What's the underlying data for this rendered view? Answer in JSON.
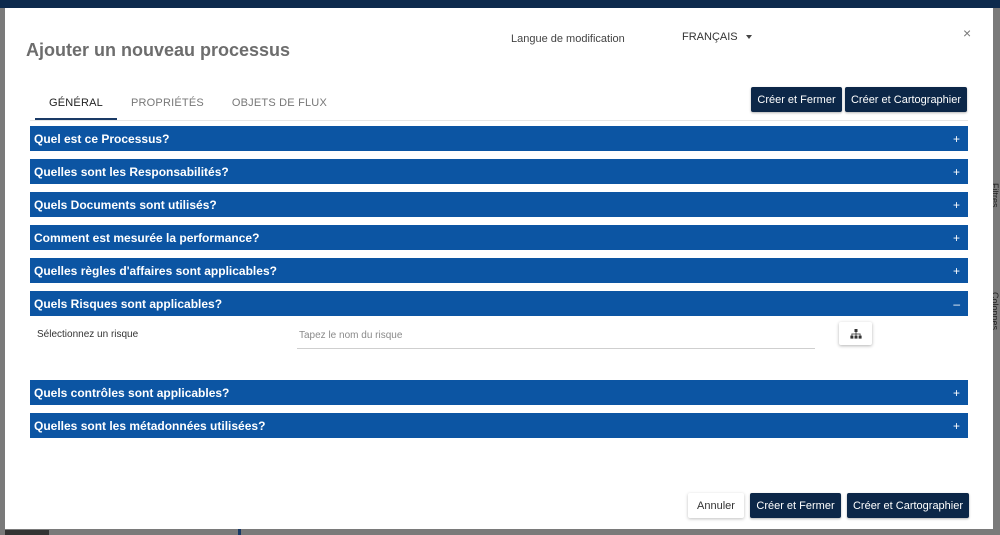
{
  "modal": {
    "title": "Ajouter un nouveau processus",
    "close_symbol": "×",
    "language_label": "Langue de modification",
    "language_value": "FRANÇAIS"
  },
  "tabs": [
    {
      "label": "GÉNÉRAL",
      "active": true
    },
    {
      "label": "PROPRIÉTÉS",
      "active": false
    },
    {
      "label": "OBJETS DE FLUX",
      "active": false
    }
  ],
  "top_actions": {
    "create_close": "Créer et Fermer",
    "create_map": "Créer et Cartographier"
  },
  "sections": [
    {
      "label": "Quel est ce Processus?",
      "sign": "+"
    },
    {
      "label": "Quelles sont les Responsabilités?",
      "sign": "+"
    },
    {
      "label": "Quels Documents sont utilisés?",
      "sign": "+"
    },
    {
      "label": "Comment est mesurée la performance?",
      "sign": "+"
    },
    {
      "label": "Quelles règles d'affaires sont applicables?",
      "sign": "+"
    },
    {
      "label": "Quels Risques sont applicables?",
      "sign": "–"
    },
    {
      "label": "Quels contrôles sont applicables?",
      "sign": "+"
    },
    {
      "label": "Quelles sont les métadonnées utilisées?",
      "sign": "+"
    }
  ],
  "risk": {
    "label": "Sélectionnez un risque",
    "placeholder": "Tapez le nom du risque",
    "value": ""
  },
  "footer": {
    "cancel": "Annuler",
    "create_close": "Créer et Fermer",
    "create_map": "Créer et Cartographier"
  },
  "background": {
    "side_tab_1": "Filtres",
    "side_tab_2": "Colonnes"
  },
  "colors": {
    "section_bg": "#0c55a3",
    "button_dark": "#0c2748",
    "tab_underline": "#1a3a66"
  },
  "icons": {
    "close": "close-icon",
    "dropdown": "caret-down-icon",
    "hierarchy": "hierarchy-icon"
  }
}
